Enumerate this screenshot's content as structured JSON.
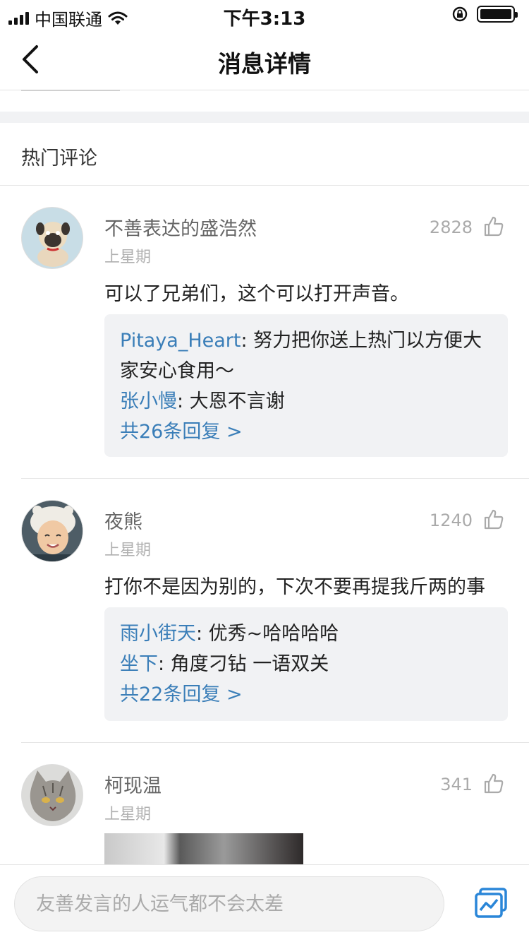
{
  "status_bar": {
    "carrier": "中国联通",
    "time": "下午3:13"
  },
  "nav": {
    "title": "消息详情"
  },
  "section": {
    "title": "热门评论"
  },
  "comments": [
    {
      "name": "不善表达的盛浩然",
      "time": "上星期",
      "likes": "2828",
      "text": "可以了兄弟们，这个可以打开声音。",
      "replies": [
        {
          "user": "Pitaya_Heart",
          "text": ": 努力把你送上热门以方便大",
          "text2": "家安心食用～"
        },
        {
          "user": "张小慢",
          "text": ": 大恩不言谢"
        }
      ],
      "more": "共26条回复 >"
    },
    {
      "name": "夜熊",
      "time": "上星期",
      "likes": "1240",
      "text": "打你不是因为别的，下次不要再提我斤两的事",
      "replies": [
        {
          "user": "雨小街天",
          "text": ": 优秀~哈哈哈哈"
        },
        {
          "user": "坐下",
          "text": ": 角度刁钻 一语双关"
        }
      ],
      "more": "共22条回复 >"
    },
    {
      "name": "柯现温",
      "time": "上星期",
      "likes": "341"
    }
  ],
  "input": {
    "placeholder": "友善发言的人运气都不会太差"
  },
  "colors": {
    "link": "#3a7eb8",
    "reply_bg": "#f1f2f4"
  }
}
